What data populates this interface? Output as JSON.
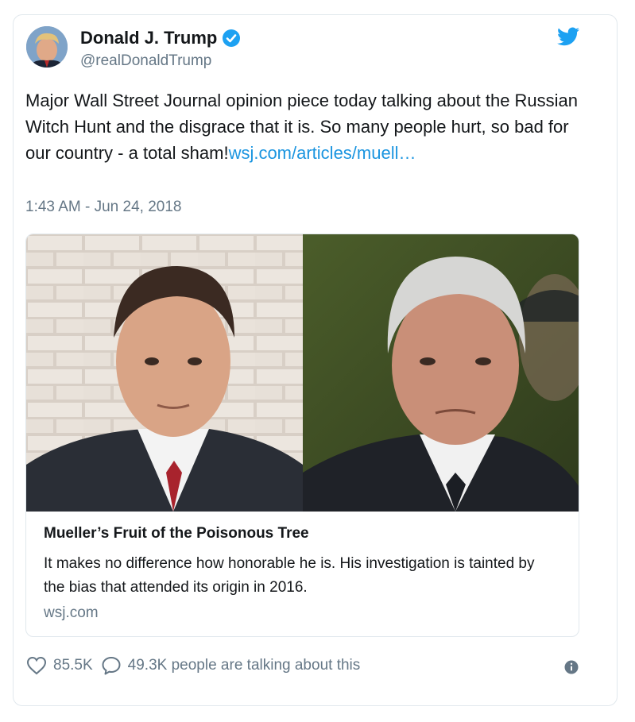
{
  "tweet": {
    "author_name": "Donald J. Trump",
    "handle": "@realDonaldTrump",
    "text": "Major Wall Street Journal opinion piece today talking about the Russian Witch Hunt and the disgrace that it is. So many people hurt, so bad for our country - a total sham!",
    "link_text": "wsj.com/articles/muell…",
    "timestamp": "1:43 AM - Jun 24, 2018"
  },
  "card": {
    "title": "Mueller’s Fruit of the Poisonous Tree",
    "description": "It makes no difference how honorable he is. His investigation is tainted by the bias that attended its origin in 2016.",
    "domain": "wsj.com"
  },
  "actions": {
    "likes": "85.5K",
    "replies": "49.3K people are talking about this"
  },
  "icons": {
    "verified": "verified-badge-icon",
    "twitter": "twitter-bird-icon",
    "like": "heart-icon",
    "reply": "comment-bubble-icon",
    "info": "info-icon"
  },
  "colors": {
    "link": "#1b95e0",
    "secondary_text": "#657786",
    "border": "#e1e8ed"
  }
}
